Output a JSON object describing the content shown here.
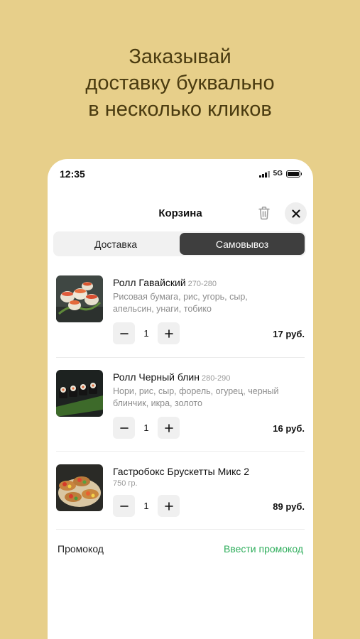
{
  "headline": {
    "line1": "Заказывай",
    "line2": "доставку буквально",
    "line3": "в несколько кликов"
  },
  "status": {
    "time": "12:35",
    "network": "5G"
  },
  "cart": {
    "title": "Корзина",
    "tabs": [
      {
        "label": "Доставка",
        "active": false
      },
      {
        "label": "Самовывоз",
        "active": true
      }
    ],
    "items": [
      {
        "name": "Ролл Гавайский",
        "weight": "270-280",
        "description": "Рисовая бумага, рис, угорь, сыр, апельсин, унаги, тобико",
        "quantity": "1",
        "price": "17 руб."
      },
      {
        "name": "Ролл Черный блин",
        "weight": "280-290",
        "description": "Нори, рис, сыр, форель, огурец, черный блинчик, икра, золото",
        "quantity": "1",
        "price": "16 руб."
      },
      {
        "name": "Гастробокс Брускетты Микс 2",
        "weight": "750 гр.",
        "quantity": "1",
        "price": "89 руб."
      }
    ],
    "promo_label": "Промокод",
    "promo_action": "Ввести промокод"
  },
  "colors": {
    "background": "#e7cf8a",
    "headline": "#4a3b10",
    "accent_green": "#2fae5c",
    "active_tab": "#3e3e3e"
  },
  "icons": [
    "signal-icon",
    "battery-icon",
    "trash-icon",
    "close-icon",
    "minus-icon",
    "plus-icon"
  ]
}
